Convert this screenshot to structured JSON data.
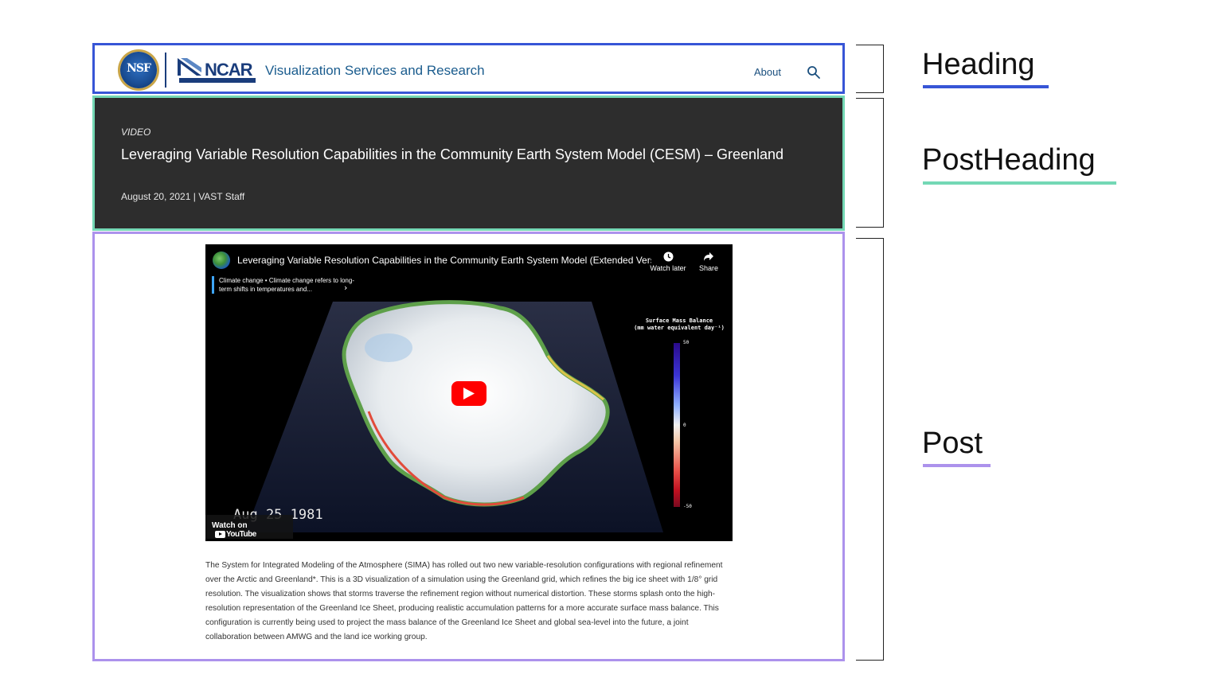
{
  "header": {
    "nsf_logo_text": "NSF",
    "ncar_logo_text": "NCAR",
    "site_title": "Visualization Services and Research",
    "nav": {
      "about_label": "About"
    }
  },
  "post_heading": {
    "type": "VIDEO",
    "title": "Leveraging Variable Resolution Capabilities in the Community Earth System Model (CESM) – Greenland",
    "meta": "August 20, 2021 | VAST Staff"
  },
  "post": {
    "video": {
      "title": "Leveraging Variable Resolution Capabilities in the Community Earth System Model (Extended Vers...",
      "watch_later_label": "Watch later",
      "share_label": "Share",
      "info_card_text": "Climate change • Climate change refers to long-term shifts in temperatures and...",
      "legend_title_line1": "Surface Mass Balance",
      "legend_title_line2": "(mm water equivalent day⁻¹)",
      "legend_ticks": [
        "50",
        "0",
        "-50"
      ],
      "frame_date": "Aug 25 1981",
      "watch_on_label": "Watch on",
      "youtube_label": "YouTube"
    },
    "body": "The System for Integrated Modeling of the Atmosphere (SIMA) has rolled out two new variable-resolution configurations with regional refinement over the Arctic and Greenland*. This is a 3D visualization of a simulation using the Greenland grid, which refines the big ice sheet with 1/8° grid resolution. The visualization shows that storms traverse the refinement region without numerical distortion. These storms splash onto the high-resolution representation of the Greenland Ice Sheet, producing realistic accumulation patterns for a more accurate surface mass balance. This configuration is currently being used to project the mass balance of the Greenland Ice Sheet and global sea-level into the future, a joint collaboration between AMWG and the land ice working group."
  },
  "annotations": {
    "heading_label": "Heading",
    "postheading_label": "PostHeading",
    "post_label": "Post",
    "heading_color": "#3755d6",
    "postheading_color": "#74d8b5",
    "post_color": "#ac92ec"
  }
}
